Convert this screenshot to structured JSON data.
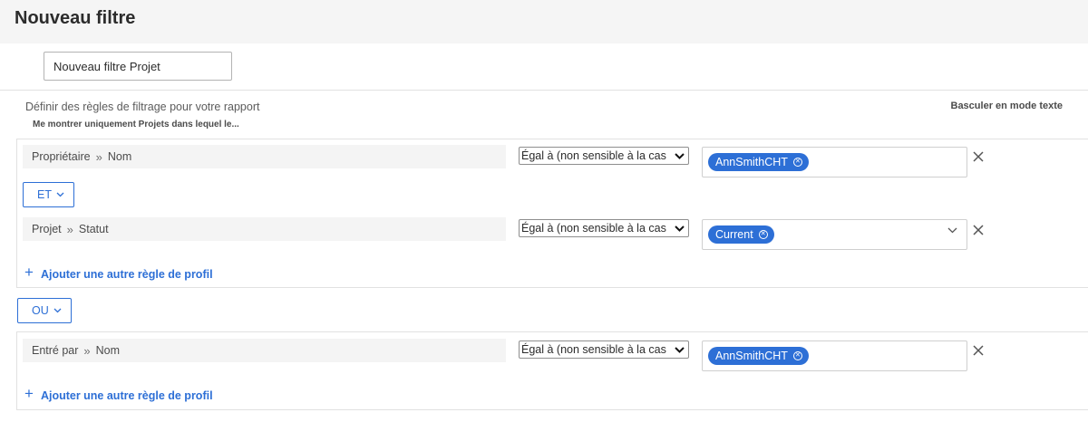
{
  "header": {
    "title": "Nouveau filtre"
  },
  "filter_name": {
    "value": "Nouveau filtre Projet"
  },
  "rules_section": {
    "define_label": "Définir des règles de filtrage pour votre rapport",
    "toggle_text_mode": "Basculer en mode texte",
    "subtitle": "Me montrer uniquement Projets dans lequel le..."
  },
  "groups": [
    {
      "rules": [
        {
          "object": "Propriétaire",
          "field": "Nom",
          "operator": "Égal à (non sensible à la cas",
          "value_chip": "AnnSmithCHT"
        },
        {
          "object": "Projet",
          "field": "Statut",
          "operator": "Égal à (non sensible à la cas",
          "value_chip": "Current"
        }
      ],
      "and_label": "ET",
      "add_rule_label": "Ajouter une autre règle de profil"
    },
    {
      "rules": [
        {
          "object": "Entré par",
          "field": "Nom",
          "operator": "Égal à (non sensible à la cas",
          "value_chip": "AnnSmithCHT"
        }
      ],
      "add_rule_label": "Ajouter une autre règle de profil"
    }
  ],
  "or_label": "OU",
  "colors": {
    "accent": "#2d6fd6",
    "header_bg": "#f5f5f5",
    "field_bg": "#f4f4f4"
  }
}
